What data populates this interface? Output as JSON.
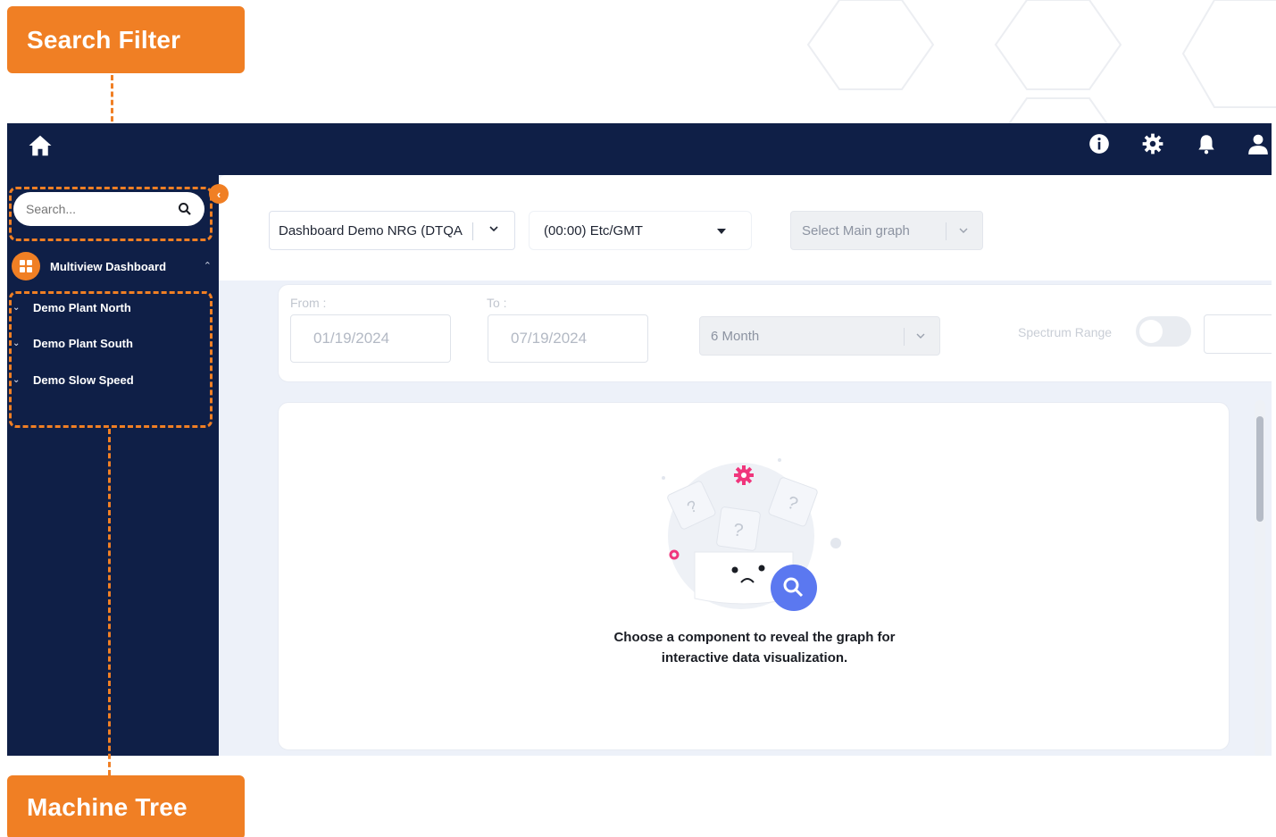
{
  "callouts": {
    "search_filter": "Search Filter",
    "machine_tree": "Machine Tree"
  },
  "topbar": {
    "icons": [
      "home-icon",
      "info-icon",
      "gear-icon",
      "bell-icon",
      "user-icon"
    ]
  },
  "sidebar": {
    "search_placeholder": "Search...",
    "group": {
      "label": "Multiview Dashboard",
      "icon": "grid-icon"
    },
    "items": [
      {
        "label": "Demo Plant North"
      },
      {
        "label": "Demo Plant South"
      },
      {
        "label": "Demo Slow Speed"
      }
    ]
  },
  "main": {
    "dashboard_select": "Dashboard Demo NRG (DTQA",
    "timezone_select": "(00:00) Etc/GMT",
    "graph_select_placeholder": "Select Main graph",
    "from_label": "From :",
    "to_label": "To :",
    "from_date": "01/19/2024",
    "to_date": "07/19/2024",
    "period_select": "6 Month",
    "spectrum_label": "Spectrum Range",
    "spectrum_enabled": false,
    "empty_message_line1": "Choose a component to reveal the graph for",
    "empty_message_line2": "interactive data visualization."
  },
  "colors": {
    "navy": "#0f1f47",
    "accent_orange": "#f07f24",
    "search_fab": "#5b78f0",
    "gear_pink": "#f0367c"
  }
}
